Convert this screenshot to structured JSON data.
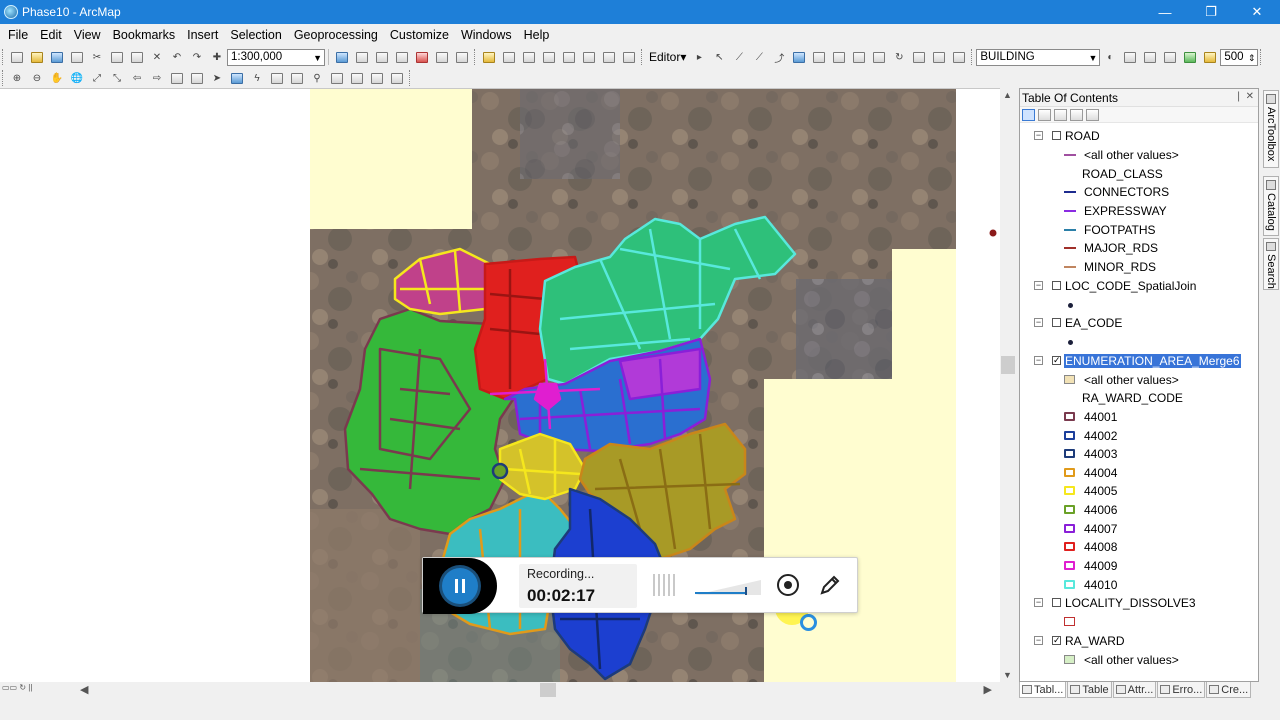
{
  "window": {
    "title": "Phase10 - ArcMap",
    "buttons": [
      "—",
      "❐",
      "✕"
    ]
  },
  "menu": [
    "File",
    "Edit",
    "View",
    "Bookmarks",
    "Insert",
    "Selection",
    "Geoprocessing",
    "Customize",
    "Windows",
    "Help"
  ],
  "toolbar": {
    "scale_value": "1:300,000",
    "editor_label": "Editor▾",
    "layer_combo": "BUILDING",
    "snap_value": "500"
  },
  "toc": {
    "title": "Table Of Contents",
    "header_buttons": "❘ ✕",
    "layers": [
      {
        "name": "ROAD",
        "checked": false
      },
      {
        "name": "LOC_CODE_SpatialJoin",
        "checked": false
      },
      {
        "name": "EA_CODE",
        "checked": false
      },
      {
        "name": "ENUMERATION_AREA_Merge6",
        "checked": true,
        "selected": true
      },
      {
        "name": "LOCALITY_DISSOLVE3",
        "checked": false
      },
      {
        "name": "RA_WARD",
        "checked": true
      }
    ],
    "road": {
      "all_other": "<all other values>",
      "field": "ROAD_CLASS",
      "classes": [
        {
          "label": "CONNECTORS",
          "color": "#1d2b8f"
        },
        {
          "label": "EXPRESSWAY",
          "color": "#8a2be2"
        },
        {
          "label": "FOOTPATHS",
          "color": "#2b7fa8"
        },
        {
          "label": "MAJOR_RDS",
          "color": "#a0302a"
        },
        {
          "label": "MINOR_RDS",
          "color": "#c08560"
        }
      ],
      "all_other_color": "#a050a0"
    },
    "ea": {
      "all_other": "<all other values>",
      "field": "RA_WARD_CODE",
      "classes": [
        {
          "label": "44001",
          "color": "#7a3a4e"
        },
        {
          "label": "44002",
          "color": "#1c3f9c"
        },
        {
          "label": "44003",
          "color": "#1d3b7a"
        },
        {
          "label": "44004",
          "color": "#e09a1b"
        },
        {
          "label": "44005",
          "color": "#f5e71d"
        },
        {
          "label": "44006",
          "color": "#6aa127"
        },
        {
          "label": "44007",
          "color": "#8a1fd8"
        },
        {
          "label": "44008",
          "color": "#e0201e"
        },
        {
          "label": "44009",
          "color": "#e01ed0"
        },
        {
          "label": "44010",
          "color": "#58e8dc"
        }
      ]
    },
    "ra_ward_all_other": "<all other values>"
  },
  "toc_tabs": [
    "Tabl...",
    "Table",
    "Attr...",
    "Erro...",
    "Cre..."
  ],
  "right_dock": [
    "ArcToolbox",
    "Catalog",
    "Search"
  ],
  "recorder": {
    "status": "Recording...",
    "time": "00:02:17"
  }
}
